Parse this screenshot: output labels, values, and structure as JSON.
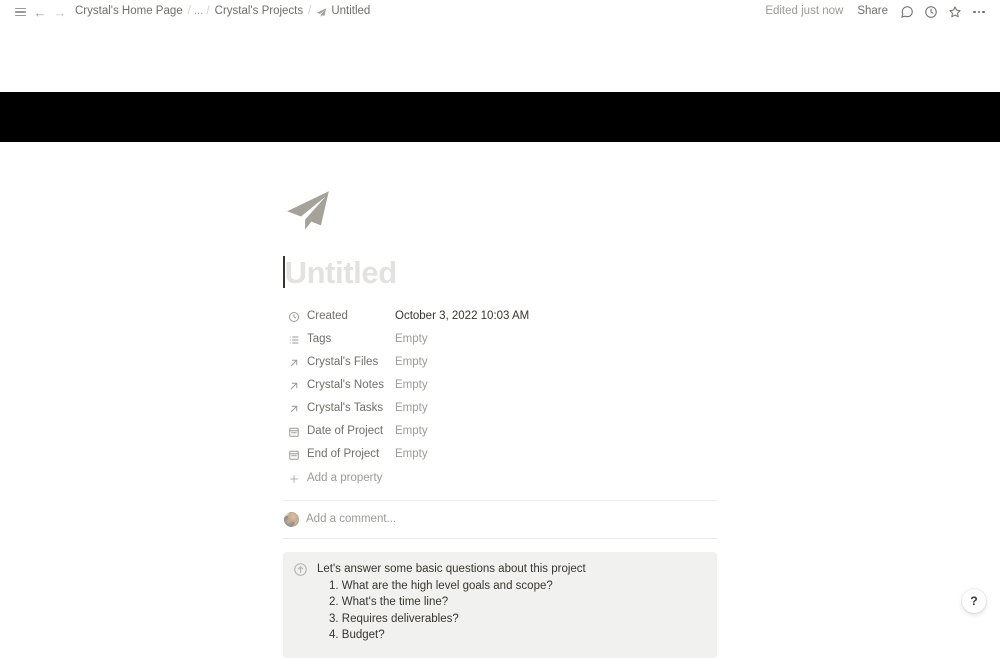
{
  "topbar": {
    "menu_icon": "hamburger-icon",
    "back_icon": "arrow-left-icon",
    "forward_icon": "arrow-right-icon",
    "breadcrumbs": [
      {
        "label": "Crystal's Home Page",
        "icon": null
      },
      {
        "label": "...",
        "icon": null
      },
      {
        "label": "Crystal's Projects",
        "icon": null
      },
      {
        "label": "Untitled",
        "icon": "paper-plane-icon"
      }
    ],
    "separator": "/",
    "edited_status": "Edited just now",
    "share_label": "Share",
    "comment_icon": "comment-icon",
    "history_icon": "clock-icon",
    "favorite_icon": "star-icon",
    "more_icon": "more-horizontal-icon"
  },
  "cover": {
    "color": "#000000"
  },
  "page": {
    "icon": "paper-plane-icon",
    "title_placeholder": "Untitled"
  },
  "properties": [
    {
      "icon": "clock-icon",
      "name": "Created",
      "value": "October 3, 2022 10:03 AM",
      "empty": false
    },
    {
      "icon": "list-icon",
      "name": "Tags",
      "value": "Empty",
      "empty": true
    },
    {
      "icon": "arrow-up-right-icon",
      "name": "Crystal's Files",
      "value": "Empty",
      "empty": true
    },
    {
      "icon": "arrow-up-right-icon",
      "name": "Crystal's Notes",
      "value": "Empty",
      "empty": true
    },
    {
      "icon": "arrow-up-right-icon",
      "name": "Crystal's Tasks",
      "value": "Empty",
      "empty": true
    },
    {
      "icon": "calendar-icon",
      "name": "Date of Project",
      "value": "Empty",
      "empty": true
    },
    {
      "icon": "calendar-icon",
      "name": "End of Project",
      "value": "Empty",
      "empty": true
    }
  ],
  "add_property": {
    "icon": "plus-icon",
    "label": "Add a property"
  },
  "comment": {
    "avatar": "user-avatar",
    "placeholder": "Add a comment..."
  },
  "callout": {
    "icon": "circle-arrow-up-icon",
    "background": "#f1f1ef",
    "heading": "Let's answer some basic questions about this project",
    "items": [
      "1. What are the high level goals and scope?",
      "2. What's the time line?",
      "3. Requires deliverables?",
      "4. Budget?"
    ]
  },
  "help": {
    "label": "?"
  }
}
